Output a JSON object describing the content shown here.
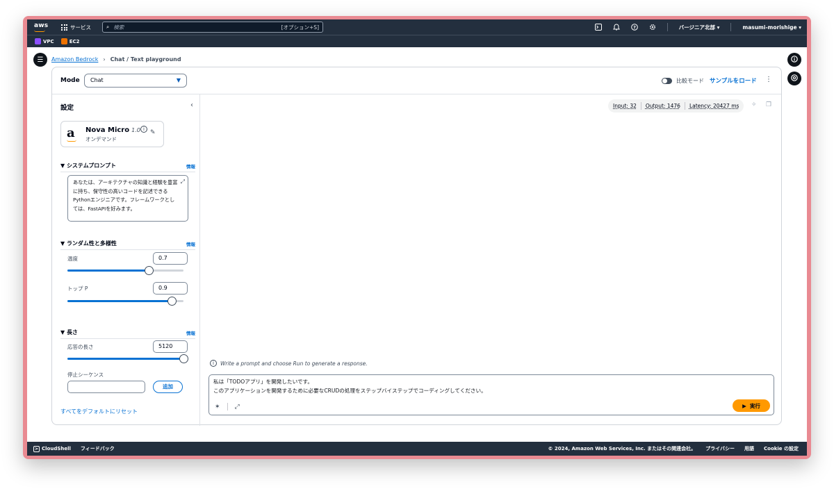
{
  "topnav": {
    "logo": "aws",
    "services": "サービス",
    "search_placeholder": "検索",
    "search_shortcut": "[オプション+S]",
    "region": "バージニア北部 ▾",
    "user": "masumi-morishige ▾"
  },
  "favorites": [
    {
      "label": "VPC",
      "color": "#8c4fff"
    },
    {
      "label": "EC2",
      "color": "#ed7100"
    }
  ],
  "breadcrumb": {
    "parent": "Amazon Bedrock",
    "current": "Chat / Text playground"
  },
  "modebar": {
    "mode_label": "Mode",
    "mode_value": "Chat",
    "compare_mode": "比較モード",
    "load_sample": "サンプルをロード"
  },
  "settings": {
    "title": "設定",
    "model": {
      "logo": "a",
      "name": "Nova Micro",
      "version": "1.0",
      "subtitle": "オンデマンド"
    },
    "system_prompt": {
      "heading": "システムプロンプト",
      "info": "情報",
      "text": "あなたは、アーキテクチャの知識と経験を豊富に持ち、保守性の高いコードを記述できるPythonエンジニアです。フレームワークとしては、FastAPIを好みます。"
    },
    "randomness": {
      "heading": "ランダム性と多様性",
      "info": "情報",
      "temperature_label": "温度",
      "temperature_value": "0.7",
      "temperature_fraction": 0.7,
      "top_p_label": "トップ P",
      "top_p_value": "0.9",
      "top_p_fraction": 0.9
    },
    "length": {
      "heading": "長さ",
      "info": "情報",
      "response_length_label": "応答の長さ",
      "response_length_value": "5120",
      "response_length_fraction": 1.0,
      "stop_sequences_label": "停止シーケンス",
      "add_button": "追加"
    },
    "reset_link": "すべてをデフォルトにリセット"
  },
  "metrics": {
    "input": "Input: 32",
    "output": "Output: 1476",
    "latency": "Latency: 20427 ms"
  },
  "chat": {
    "hint": "Write a prompt and choose Run to generate a response.",
    "input_line1": "私は「TODOアプリ」を開発したいです。",
    "input_line2": "このアプリケーションを開発するために必要なCRUDの処理をステップバイステップでコーディングしてください。",
    "run_button": "実行"
  },
  "footer": {
    "cloudshell": "CloudShell",
    "feedback": "フィードバック",
    "copyright": "© 2024, Amazon Web Services, Inc. またはその関連会社。",
    "privacy": "プライバシー",
    "terms": "用語",
    "cookie": "Cookie の設定"
  }
}
